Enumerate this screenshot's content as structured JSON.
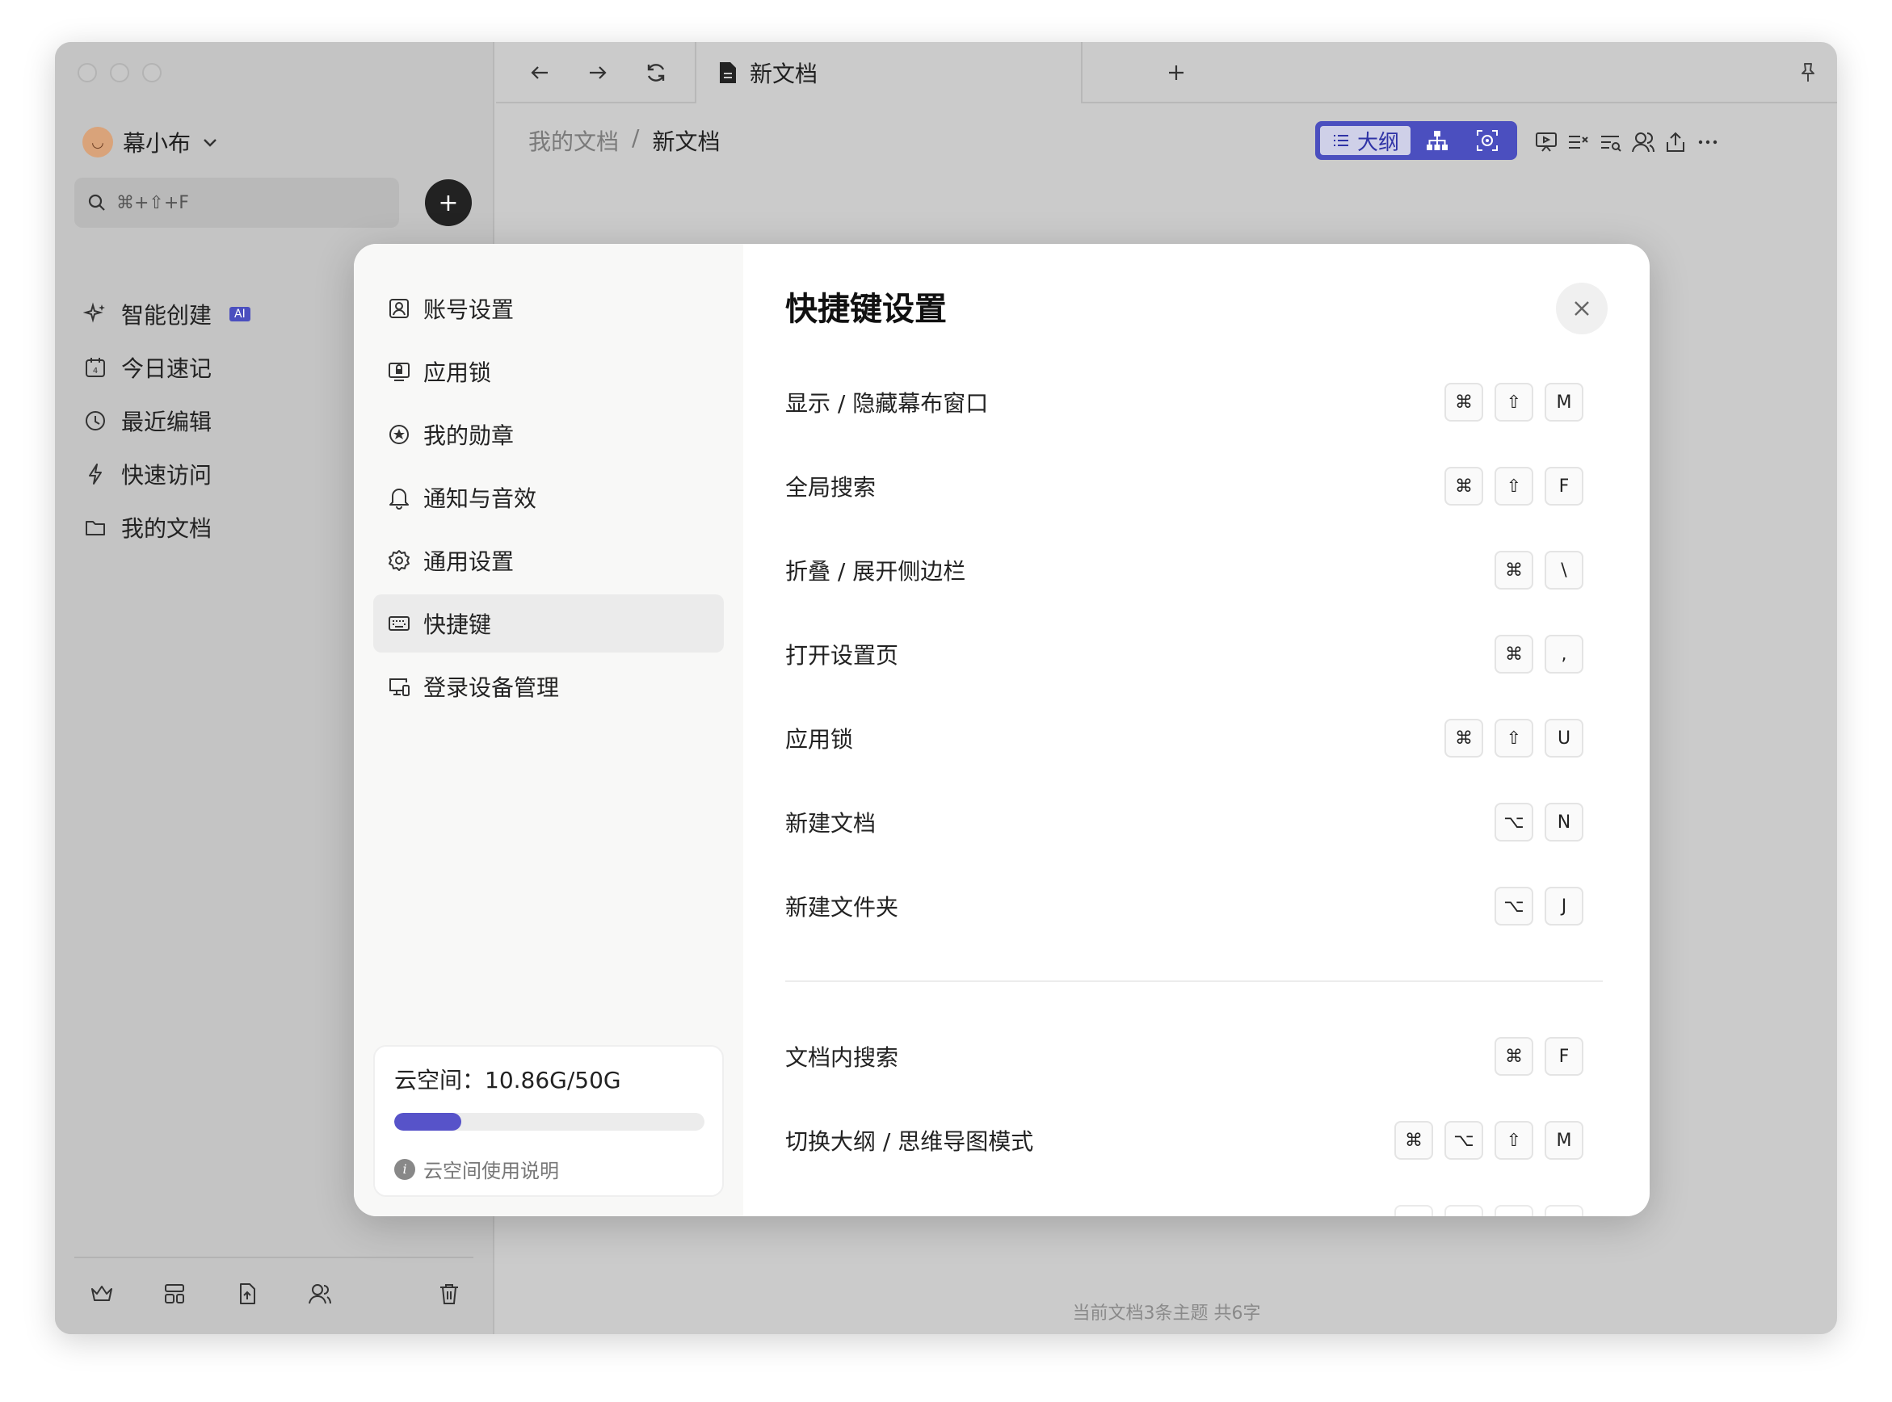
{
  "sidebar": {
    "user_name": "幕小布",
    "search_placeholder": "⌘+⇧+F",
    "nav": [
      {
        "label": "智能创建",
        "badge": "AI"
      },
      {
        "label": "今日速记"
      },
      {
        "label": "最近编辑"
      },
      {
        "label": "快速访问"
      },
      {
        "label": "我的文档"
      }
    ]
  },
  "tab": {
    "title": "新文档"
  },
  "breadcrumb": {
    "root": "我的文档",
    "separator": "/",
    "current": "新文档"
  },
  "view_mode": {
    "outline_label": "大纲"
  },
  "status_bar": "当前文档3条主题 共6字",
  "modal": {
    "title": "快捷键设置",
    "nav": [
      {
        "label": "账号设置",
        "icon": "account-icon"
      },
      {
        "label": "应用锁",
        "icon": "lock-icon"
      },
      {
        "label": "我的勋章",
        "icon": "medal-icon"
      },
      {
        "label": "通知与音效",
        "icon": "bell-icon"
      },
      {
        "label": "通用设置",
        "icon": "gear-icon"
      },
      {
        "label": "快捷键",
        "icon": "keyboard-icon",
        "active": true
      },
      {
        "label": "登录设备管理",
        "icon": "devices-icon"
      }
    ],
    "storage": {
      "label": "云空间：10.86G/50G",
      "used_fraction": 0.2172,
      "help": "云空间使用说明"
    },
    "shortcuts_global": [
      {
        "label": "显示 / 隐藏幕布窗口",
        "keys": [
          "⌘",
          "⇧",
          "M"
        ]
      },
      {
        "label": "全局搜索",
        "keys": [
          "⌘",
          "⇧",
          "F"
        ]
      },
      {
        "label": "折叠 / 展开侧边栏",
        "keys": [
          "⌘",
          "\\"
        ]
      },
      {
        "label": "打开设置页",
        "keys": [
          "⌘",
          ","
        ]
      },
      {
        "label": "应用锁",
        "keys": [
          "⌘",
          "⇧",
          "U"
        ]
      },
      {
        "label": "新建文档",
        "keys": [
          "⌥",
          "N"
        ]
      },
      {
        "label": "新建文件夹",
        "keys": [
          "⌥",
          "J"
        ]
      }
    ],
    "shortcuts_document": [
      {
        "label": "文档内搜索",
        "keys": [
          "⌘",
          "F"
        ]
      },
      {
        "label": "切换大纲 / 思维导图模式",
        "keys": [
          "⌘",
          "⌥",
          "⇧",
          "M"
        ]
      }
    ]
  }
}
